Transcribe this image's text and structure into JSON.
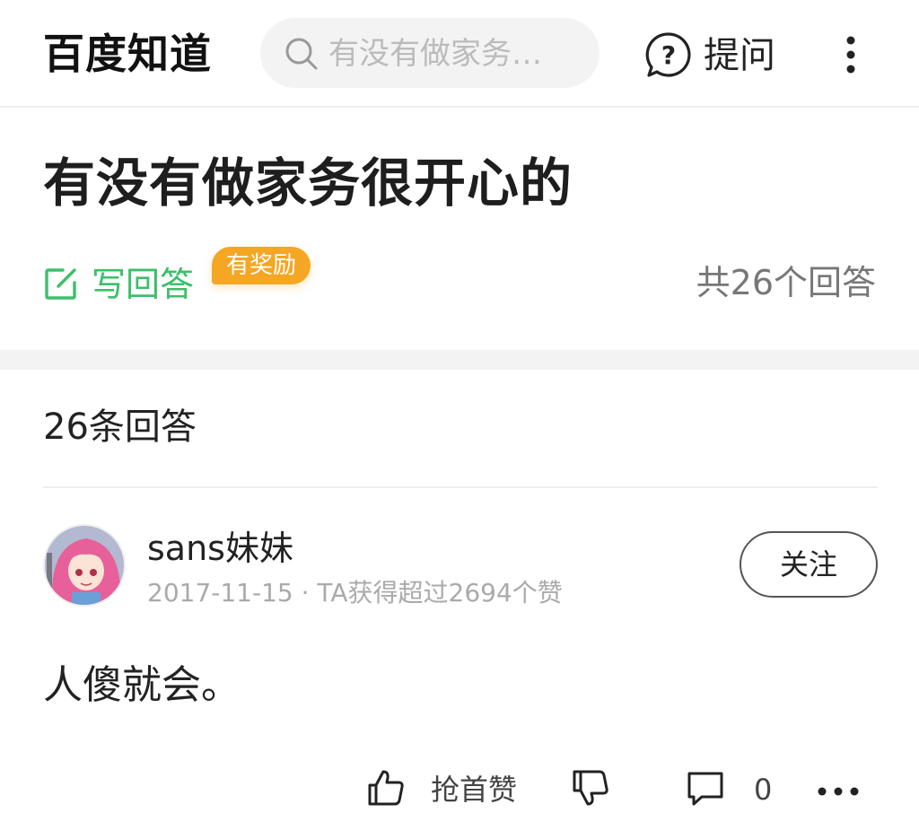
{
  "header": {
    "logo": "百度知道",
    "search_placeholder": "有没有做家务…",
    "ask_label": "提问",
    "icons": {
      "search": "search-icon",
      "ask": "question-bubble-icon",
      "more": "more-vertical-icon"
    }
  },
  "question": {
    "title": "有没有做家务很开心的",
    "write_answer_label": "写回答",
    "reward_badge": "有奖励",
    "total_answers": "共26个回答"
  },
  "answers_section": {
    "count_label": "26条回答"
  },
  "answer": {
    "username": "sans妹妹",
    "meta": "2017-11-15 · TA获得超过2694个赞",
    "follow_label": "关注",
    "content": "人傻就会。",
    "actions": {
      "like_label": "抢首赞",
      "comment_count": "0"
    }
  },
  "colors": {
    "accent_green": "#3dbf6a",
    "reward_orange": "#f5a623",
    "muted_text": "#aaaaaa",
    "band_gray": "#f3f3f3"
  }
}
